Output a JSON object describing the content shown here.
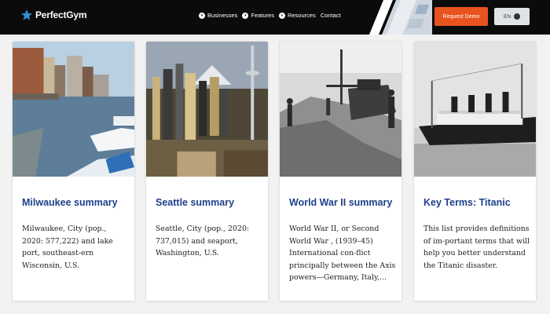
{
  "header": {
    "logo_text": "PerfectGym",
    "nav": [
      {
        "label": "Businesses"
      },
      {
        "label": "Features"
      },
      {
        "label": "Resources"
      },
      {
        "label": "Contact"
      }
    ],
    "request_demo_label": "Request Demo",
    "language_label": "EN"
  },
  "colors": {
    "header_bg": "#0b0b0b",
    "accent": "#e8531f",
    "title_blue": "#1d3f8a",
    "logo_star": "#2e8fd6"
  },
  "cards": [
    {
      "image_icon": "city-harbor-photo",
      "title": "Milwaukee summary",
      "description": "Milwaukee, City (pop., 2020: 577,222) and lake port, southeast-ern Wisconsin, U.S."
    },
    {
      "image_icon": "city-skyline-photo",
      "title": "Seattle summary",
      "description": "Seattle, City (pop., 2020: 737,015) and seaport, Washington, U.S."
    },
    {
      "image_icon": "tank-war-photo",
      "title": "World War II summary",
      "description": "World War II, or Second World War , (1939–45) International con-flict principally between the Axis powers—Germany, Italy,..."
    },
    {
      "image_icon": "ship-photo",
      "title": "Key Terms: Titanic",
      "description": "This list provides definitions of im-portant terms that will help you better understand the Titanic disaster."
    }
  ]
}
